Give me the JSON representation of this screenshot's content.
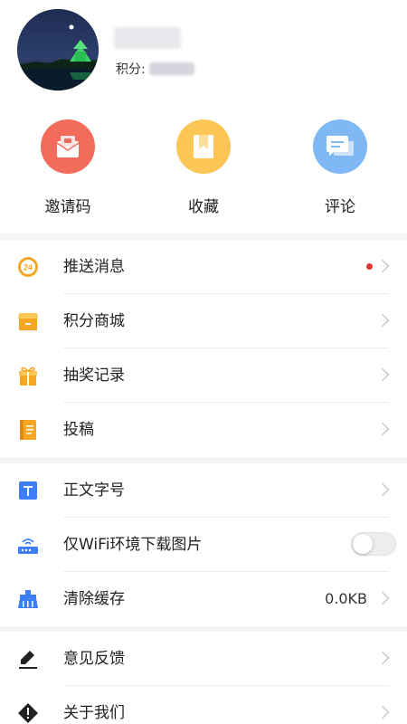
{
  "profile": {
    "points_label": "积分:"
  },
  "quick_actions": [
    {
      "label": "邀请码",
      "icon": "mail-envelope-icon",
      "color": "#f26b5b"
    },
    {
      "label": "收藏",
      "icon": "bookmark-icon",
      "color": "#fbc656"
    },
    {
      "label": "评论",
      "icon": "chat-bubble-icon",
      "color": "#7fb8f5"
    }
  ],
  "menu_group_1": [
    {
      "label": "推送消息",
      "icon": "clock-24-icon",
      "has_badge": true
    },
    {
      "label": "积分商城",
      "icon": "store-icon"
    },
    {
      "label": "抽奖记录",
      "icon": "gift-icon"
    },
    {
      "label": "投稿",
      "icon": "notebook-icon"
    }
  ],
  "menu_group_2": [
    {
      "label": "正文字号",
      "icon": "text-size-icon"
    },
    {
      "label": "仅WiFi环境下载图片",
      "icon": "router-icon",
      "toggle_on": false
    },
    {
      "label": "清除缓存",
      "icon": "broom-icon",
      "value": "0.0KB"
    }
  ],
  "menu_group_3": [
    {
      "label": "意见反馈",
      "icon": "pencil-icon"
    },
    {
      "label": "关于我们",
      "icon": "info-icon"
    }
  ],
  "colors": {
    "badge_red": "#e53333",
    "orange": "#f5a623",
    "blue": "#3b7ef6"
  }
}
